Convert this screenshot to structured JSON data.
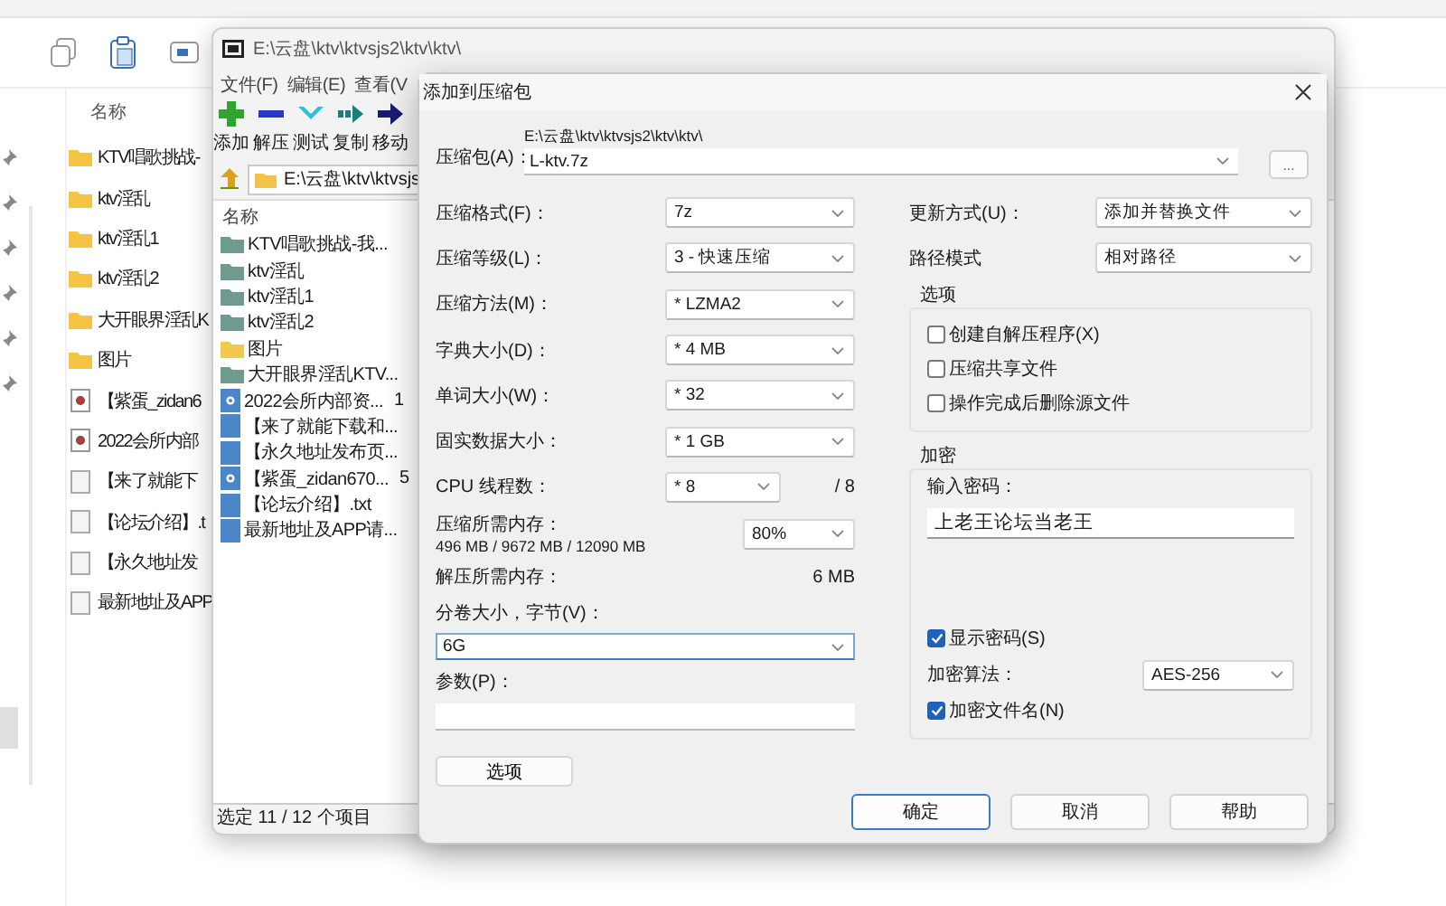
{
  "explorer": {
    "column_header": "名称",
    "files": [
      {
        "name": "KTV唱歌挑战-",
        "kind": "folder"
      },
      {
        "name": "ktv淫乱",
        "kind": "folder"
      },
      {
        "name": "ktv淫乱1",
        "kind": "folder"
      },
      {
        "name": "ktv淫乱2",
        "kind": "folder"
      },
      {
        "name": "大开眼界淫乱K",
        "kind": "folder"
      },
      {
        "name": "图片",
        "kind": "folder"
      },
      {
        "name": "【紫蛋_zidan6",
        "kind": "video"
      },
      {
        "name": "2022会所内部",
        "kind": "video"
      },
      {
        "name": "【来了就能下",
        "kind": "text"
      },
      {
        "name": "【论坛介绍】.t",
        "kind": "text"
      },
      {
        "name": "【永久地址发",
        "kind": "text"
      },
      {
        "name": "最新地址及APP",
        "kind": "text"
      }
    ]
  },
  "archive_manager": {
    "title": "E:\\云盘\\ktv\\ktvsjs2\\ktv\\ktv\\",
    "menu": [
      "文件(F)",
      "编辑(E)",
      "查看(V"
    ],
    "toolbar": [
      {
        "label": "添加",
        "kind": "add"
      },
      {
        "label": "解压",
        "kind": "extract"
      },
      {
        "label": "测试",
        "kind": "test"
      },
      {
        "label": "复制",
        "kind": "copy"
      },
      {
        "label": "移动",
        "kind": "move"
      }
    ],
    "address": "E:\\云盘\\ktv\\ktvsjs",
    "column_header": "名称",
    "items": [
      {
        "name": "KTV唱歌挑战-我...",
        "kind": "folder",
        "color": "#6f9a90"
      },
      {
        "name": "ktv淫乱",
        "kind": "folder",
        "color": "#6f9a90"
      },
      {
        "name": "ktv淫乱1",
        "kind": "folder",
        "color": "#6f9a90"
      },
      {
        "name": "ktv淫乱2",
        "kind": "folder",
        "color": "#6f9a90"
      },
      {
        "name": "图片",
        "kind": "folder",
        "color": "#f2c94c"
      },
      {
        "name": "大开眼界淫乱KTV...",
        "kind": "folder",
        "color": "#6f9a90"
      },
      {
        "name": "2022会所内部资...",
        "kind": "media",
        "column_2": "1"
      },
      {
        "name": "【来了就能下载和...",
        "kind": "document"
      },
      {
        "name": "【永久地址发布页...",
        "kind": "document"
      },
      {
        "name": "【紫蛋_zidan670...",
        "kind": "media",
        "column_2": "5"
      },
      {
        "name": "【论坛介绍】.txt",
        "kind": "document"
      },
      {
        "name": "最新地址及APP请...",
        "kind": "document"
      }
    ],
    "status": "选定 11 / 12 个项目"
  },
  "dialog": {
    "title": "添加到压缩包",
    "archive_label": "压缩包(A)：",
    "archive_dir": "E:\\云盘\\ktv\\ktvsjs2\\ktv\\ktv\\",
    "archive_name": "L-ktv.7z",
    "browse": "...",
    "left": [
      {
        "kind": "select",
        "label": "压缩格式(F)：",
        "value": "7z"
      },
      {
        "kind": "select",
        "label": "压缩等级(L)：",
        "value": "3 - 快速压缩"
      },
      {
        "kind": "select",
        "label": "压缩方法(M)：",
        "value": "* LZMA2"
      },
      {
        "kind": "select",
        "label": "字典大小(D)：",
        "value": "* 4 MB"
      },
      {
        "kind": "select",
        "label": "单词大小(W)：",
        "value": "* 32"
      },
      {
        "kind": "select",
        "label": "固实数据大小：",
        "value": "* 1 GB"
      },
      {
        "kind": "threads",
        "label": "CPU 线程数：",
        "value": "* 8",
        "suffix": "/ 8"
      },
      {
        "kind": "memory",
        "label": "压缩所需内存：",
        "detail": "496 MB / 9672 MB / 12090 MB",
        "value": "80%"
      },
      {
        "kind": "info",
        "label": "解压所需内存：",
        "value": "6 MB"
      },
      {
        "kind": "combo",
        "label": "分卷大小，字节(V)：",
        "value": "6G"
      },
      {
        "kind": "input",
        "label": "参数(P)："
      }
    ],
    "options_button": "选项",
    "right": [
      {
        "label": "更新方式(U)：",
        "value": "添加并替换文件"
      },
      {
        "label": "路径模式",
        "value": "相对路径"
      }
    ],
    "options": {
      "title": "选项",
      "checkboxes": [
        {
          "label": "创建自解压程序(X)",
          "checked": false
        },
        {
          "label": "压缩共享文件",
          "checked": false
        },
        {
          "label": "操作完成后删除源文件",
          "checked": false
        }
      ]
    },
    "encryption": {
      "title": "加密",
      "password_label": "输入密码：",
      "password": "上老王论坛当老王",
      "show_password": {
        "label": "显示密码(S)",
        "checked": true
      },
      "method_label": "加密算法：",
      "method": "AES-256",
      "encrypt_names": {
        "label": "加密文件名(N)",
        "checked": true
      }
    },
    "buttons": [
      {
        "label": "确定",
        "focused": true
      },
      {
        "label": "取消",
        "focused": false
      },
      {
        "label": "帮助",
        "focused": false
      }
    ]
  }
}
